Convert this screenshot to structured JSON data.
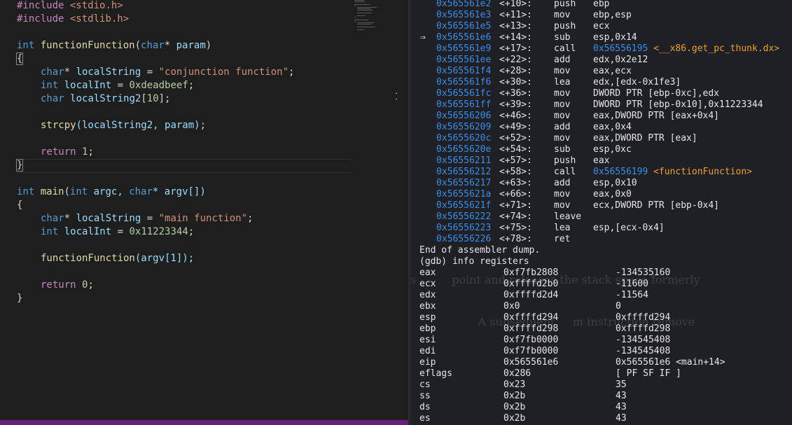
{
  "editor": {
    "lines": [
      {
        "kind": "include",
        "directive": "#include",
        "header": "<stdio.h>"
      },
      {
        "kind": "include",
        "directive": "#include",
        "header": "<stdlib.h>"
      },
      {
        "kind": "blank"
      },
      {
        "kind": "signature",
        "ret": "int",
        "name": "functionFunction",
        "open": "(",
        "ptype": "char",
        "pstar": "* ",
        "pname": "param",
        "close": ")"
      },
      {
        "kind": "brace",
        "text": "{",
        "boxed": true
      },
      {
        "kind": "decl",
        "type": "char",
        "star": "* ",
        "name": "localString",
        "op": " = ",
        "val": "\"conjunction function\"",
        "valkind": "str",
        "end": ";"
      },
      {
        "kind": "decl",
        "type": "int",
        "star": " ",
        "name": "localInt",
        "op": " = ",
        "val": "0xdeadbeef",
        "valkind": "num",
        "end": ";"
      },
      {
        "kind": "decl",
        "type": "char",
        "star": " ",
        "name": "localString2",
        "op": "[",
        "val": "10",
        "valkind": "num",
        "end": "];"
      },
      {
        "kind": "blank"
      },
      {
        "kind": "call",
        "fn": "strcpy",
        "args": "(localString2, param);"
      },
      {
        "kind": "blank"
      },
      {
        "kind": "return",
        "kw": "return",
        "val": "1",
        "end": ";"
      },
      {
        "kind": "brace",
        "text": "}",
        "boxed": true
      },
      {
        "kind": "blank"
      },
      {
        "kind": "signature2",
        "ret": "int",
        "name": "main",
        "p1": "(",
        "t1": "int",
        "n1": " argc, ",
        "t2": "char",
        "n2": "* argv[])"
      },
      {
        "kind": "brace",
        "text": "{",
        "boxed": false
      },
      {
        "kind": "decl",
        "type": "char",
        "star": "* ",
        "name": "localString",
        "op": " = ",
        "val": "\"main function\"",
        "valkind": "str",
        "end": ";"
      },
      {
        "kind": "decl",
        "type": "int",
        "star": " ",
        "name": "localInt",
        "op": " = ",
        "val": "0x11223344",
        "valkind": "num",
        "end": ";"
      },
      {
        "kind": "blank"
      },
      {
        "kind": "call",
        "fn": "functionFunction",
        "args": "(argv[1]);"
      },
      {
        "kind": "blank"
      },
      {
        "kind": "return",
        "kw": "return",
        "val": "0",
        "end": ";"
      },
      {
        "kind": "brace",
        "text": "}",
        "boxed": false
      }
    ]
  },
  "disassembly": {
    "lines": [
      {
        "arrow": "",
        "addr": "0x565561e2",
        "off": "<+10>:",
        "mnemonic": "push",
        "operands": "ebp"
      },
      {
        "arrow": "",
        "addr": "0x565561e3",
        "off": "<+11>:",
        "mnemonic": "mov",
        "operands": "ebp,esp"
      },
      {
        "arrow": "",
        "addr": "0x565561e5",
        "off": "<+13>:",
        "mnemonic": "push",
        "operands": "ecx"
      },
      {
        "arrow": "⇒",
        "addr": "0x565561e6",
        "off": "<+14>:",
        "mnemonic": "sub",
        "operands": "esp,0x14"
      },
      {
        "arrow": "",
        "addr": "0x565561e9",
        "off": "<+17>:",
        "mnemonic": "call",
        "target_addr": "0x56556195",
        "target_sym": "<__x86.get_pc_thunk.dx>"
      },
      {
        "arrow": "",
        "addr": "0x565561ee",
        "off": "<+22>:",
        "mnemonic": "add",
        "operands": "edx,0x2e12"
      },
      {
        "arrow": "",
        "addr": "0x565561f4",
        "off": "<+28>:",
        "mnemonic": "mov",
        "operands": "eax,ecx"
      },
      {
        "arrow": "",
        "addr": "0x565561f6",
        "off": "<+30>:",
        "mnemonic": "lea",
        "operands": "edx,[edx-0x1fe3]"
      },
      {
        "arrow": "",
        "addr": "0x565561fc",
        "off": "<+36>:",
        "mnemonic": "mov",
        "operands": "DWORD PTR [ebp-0xc],edx"
      },
      {
        "arrow": "",
        "addr": "0x565561ff",
        "off": "<+39>:",
        "mnemonic": "mov",
        "operands": "DWORD PTR [ebp-0x10],0x11223344"
      },
      {
        "arrow": "",
        "addr": "0x56556206",
        "off": "<+46>:",
        "mnemonic": "mov",
        "operands": "eax,DWORD PTR [eax+0x4]"
      },
      {
        "arrow": "",
        "addr": "0x56556209",
        "off": "<+49>:",
        "mnemonic": "add",
        "operands": "eax,0x4"
      },
      {
        "arrow": "",
        "addr": "0x5655620c",
        "off": "<+52>:",
        "mnemonic": "mov",
        "operands": "eax,DWORD PTR [eax]"
      },
      {
        "arrow": "",
        "addr": "0x5655620e",
        "off": "<+54>:",
        "mnemonic": "sub",
        "operands": "esp,0xc"
      },
      {
        "arrow": "",
        "addr": "0x56556211",
        "off": "<+57>:",
        "mnemonic": "push",
        "operands": "eax"
      },
      {
        "arrow": "",
        "addr": "0x56556212",
        "off": "<+58>:",
        "mnemonic": "call",
        "target_addr": "0x56556199",
        "target_sym": "<functionFunction>"
      },
      {
        "arrow": "",
        "addr": "0x56556217",
        "off": "<+63>:",
        "mnemonic": "add",
        "operands": "esp,0x10"
      },
      {
        "arrow": "",
        "addr": "0x5655621a",
        "off": "<+66>:",
        "mnemonic": "mov",
        "operands": "eax,0x0"
      },
      {
        "arrow": "",
        "addr": "0x5655621f",
        "off": "<+71>:",
        "mnemonic": "mov",
        "operands": "ecx,DWORD PTR [ebp-0x4]"
      },
      {
        "arrow": "",
        "addr": "0x56556222",
        "off": "<+74>:",
        "mnemonic": "leave",
        "operands": ""
      },
      {
        "arrow": "",
        "addr": "0x56556223",
        "off": "<+75>:",
        "mnemonic": "lea",
        "operands": "esp,[ecx-0x4]"
      },
      {
        "arrow": "",
        "addr": "0x56556226",
        "off": "<+78>:",
        "mnemonic": "ret",
        "operands": ""
      }
    ]
  },
  "ghost_text": [
    "s          point and releases the stack space formerly",
    "                   A subsequent     m instruction remove"
  ],
  "gdb": {
    "end_message": "End of assembler dump.",
    "command": "(gdb) info registers",
    "registers": [
      {
        "name": "eax",
        "hex": "0xf7fb2808",
        "natural": "-134535160"
      },
      {
        "name": "ecx",
        "hex": "0xffffd2b0",
        "natural": "-11600"
      },
      {
        "name": "edx",
        "hex": "0xffffd2d4",
        "natural": "-11564"
      },
      {
        "name": "ebx",
        "hex": "0x0",
        "natural": "0"
      },
      {
        "name": "esp",
        "hex": "0xffffd294",
        "natural": "0xffffd294"
      },
      {
        "name": "ebp",
        "hex": "0xffffd298",
        "natural": "0xffffd298"
      },
      {
        "name": "esi",
        "hex": "0xf7fb0000",
        "natural": "-134545408"
      },
      {
        "name": "edi",
        "hex": "0xf7fb0000",
        "natural": "-134545408"
      },
      {
        "name": "eip",
        "hex": "0x565561e6",
        "natural": "0x565561e6 <main+14>"
      },
      {
        "name": "eflags",
        "hex": "0x286",
        "natural": "[ PF SF IF ]"
      },
      {
        "name": "cs",
        "hex": "0x23",
        "natural": "35"
      },
      {
        "name": "ss",
        "hex": "0x2b",
        "natural": "43"
      },
      {
        "name": "ds",
        "hex": "0x2b",
        "natural": "43"
      },
      {
        "name": "es",
        "hex": "0x2b",
        "natural": "43"
      }
    ]
  },
  "colors": {
    "editor_bg": "#1e1e1e",
    "terminal_bg": "#1f1f26",
    "statusbar": "#68217a",
    "keyword": "#569cd6",
    "function": "#dcdcaa",
    "string": "#ce9178",
    "number": "#b5cea8",
    "preprocessor": "#c586c0",
    "variable": "#9cdcfe",
    "address": "#3b8eea",
    "symbol": "#f0a030"
  }
}
